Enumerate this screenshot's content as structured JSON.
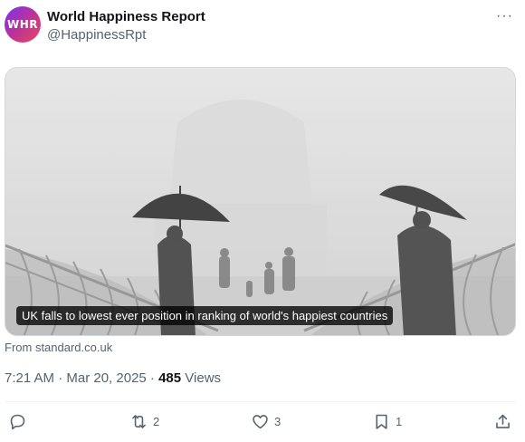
{
  "post": {
    "author_name": "World Happiness Report",
    "author_handle": "@HappinessRpt",
    "avatar_text": "WHR",
    "more_label": "···",
    "card": {
      "caption": "UK falls to lowest ever position in ranking of world's happiest countries"
    },
    "source": "From standard.co.uk",
    "time": "7:21 AM · Mar 20, 2025 · ",
    "views_count": "485",
    "views_label": " Views"
  },
  "actions": {
    "reply": {
      "icon": "reply-icon",
      "count": ""
    },
    "repost": {
      "icon": "repost-icon",
      "count": "2"
    },
    "like": {
      "icon": "heart-icon",
      "count": "3"
    },
    "bookmark": {
      "icon": "bookmark-icon",
      "count": "1"
    },
    "share": {
      "icon": "share-icon",
      "count": ""
    }
  }
}
